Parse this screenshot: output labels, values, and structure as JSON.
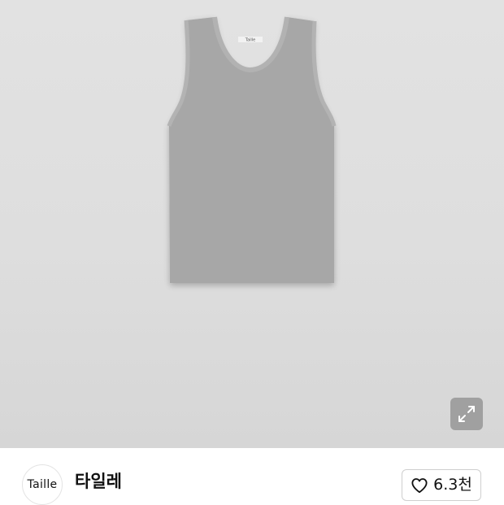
{
  "product": {
    "image_name": "gray-tank-top-icon",
    "neck_label": "Taille"
  },
  "expand": {
    "icon": "expand-arrows-icon"
  },
  "store": {
    "logo_text": "Taille",
    "name": "타일레"
  },
  "like": {
    "icon": "heart-outline-icon",
    "count": "6.3천"
  }
}
